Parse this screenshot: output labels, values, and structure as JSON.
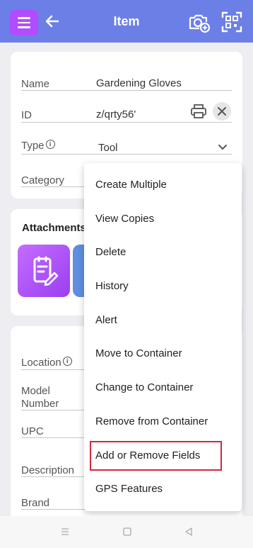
{
  "appbar": {
    "title": "Item",
    "menu_icon": "hamburger-menu-icon",
    "back_icon": "arrow-left-icon",
    "camera_icon": "camera-add-icon",
    "scan_icon": "qr-scan-icon",
    "color": "#6b7fe6",
    "menu_color": "#b14dff"
  },
  "form": {
    "name_label": "Name",
    "name_value": "Gardening Gloves",
    "id_label": "ID",
    "id_value": "z/qrty56'",
    "type_label": "Type",
    "type_value": "Tool",
    "category_label": "Category"
  },
  "attachments": {
    "title": "Attachments"
  },
  "details": {
    "location_label": "Location",
    "model_label_line1": "Model",
    "model_label_line2": "Number",
    "upc_label": "UPC",
    "description_label": "Description",
    "brand_label": "Brand"
  },
  "menu": {
    "items": [
      "Create Multiple",
      "View Copies",
      "Delete",
      "History",
      "Alert",
      "Move to Container",
      "Change to Container",
      "Remove from Container",
      "Add or Remove Fields",
      "GPS Features"
    ],
    "highlighted": "Add or Remove Fields",
    "highlight_color": "#d3283a"
  }
}
